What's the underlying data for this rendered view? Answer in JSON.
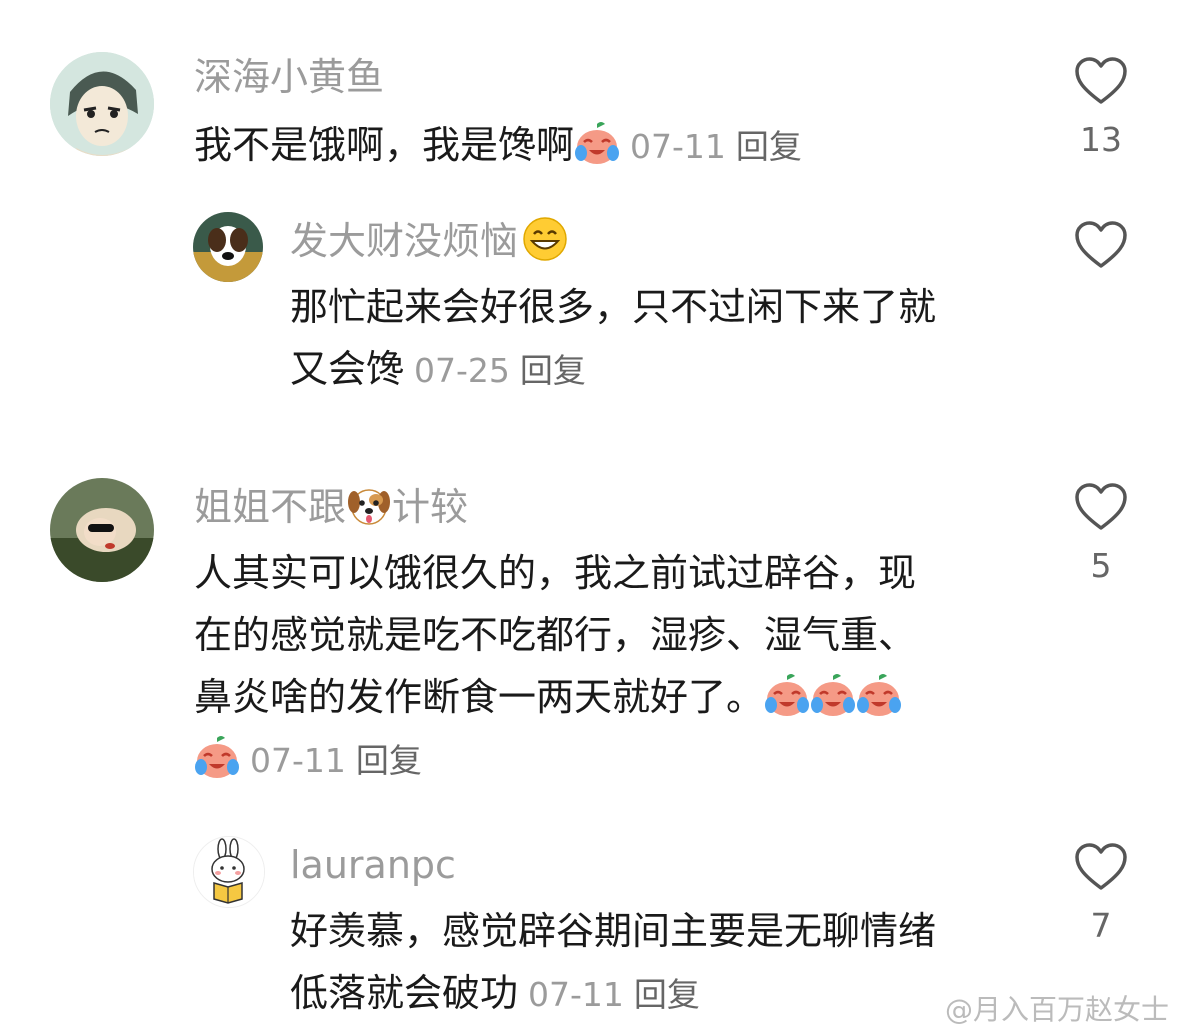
{
  "comments": [
    {
      "username": "深海小黄鱼",
      "text": "我不是饿啊，我是馋啊",
      "date": "07-11",
      "reply_label": "回复",
      "like_count": "13",
      "emoji": "crying-laughing-peach-emoji",
      "avatar_icon": "anime-character-avatar",
      "replies": [
        {
          "username": "发大财没烦恼",
          "name_emoji": "grinning-face-emoji",
          "text_lines": [
            "那忙起来会好很多，只不过闲下来了就",
            "又会馋"
          ],
          "date": "07-25",
          "reply_label": "回复",
          "like_count": "",
          "avatar_icon": "dog-photo-avatar"
        }
      ]
    },
    {
      "username_part1": "姐姐不跟",
      "name_emoji": "dog-face-emoji",
      "username_part2": "计较",
      "text_lines": [
        "人其实可以饿很久的，我之前试过辟谷，现",
        "在的感觉就是吃不吃都行，湿疹、湿气重、",
        "鼻炎啥的发作断食一两天就好了。"
      ],
      "date": "07-11",
      "reply_label": "回复",
      "like_count": "5",
      "avatar_icon": "woman-photo-avatar",
      "replies": [
        {
          "username": "lauranpc",
          "text_lines": [
            "好羡慕，感觉辟谷期间主要是无聊情绪",
            "低落就会破功"
          ],
          "date": "07-11",
          "reply_label": "回复",
          "like_count": "7",
          "avatar_icon": "rabbit-reading-avatar"
        }
      ]
    }
  ],
  "watermark": "@月入百万赵女士",
  "colors": {
    "text": "#1a1a1a",
    "muted": "#9b9b9b",
    "icon": "#555555"
  }
}
